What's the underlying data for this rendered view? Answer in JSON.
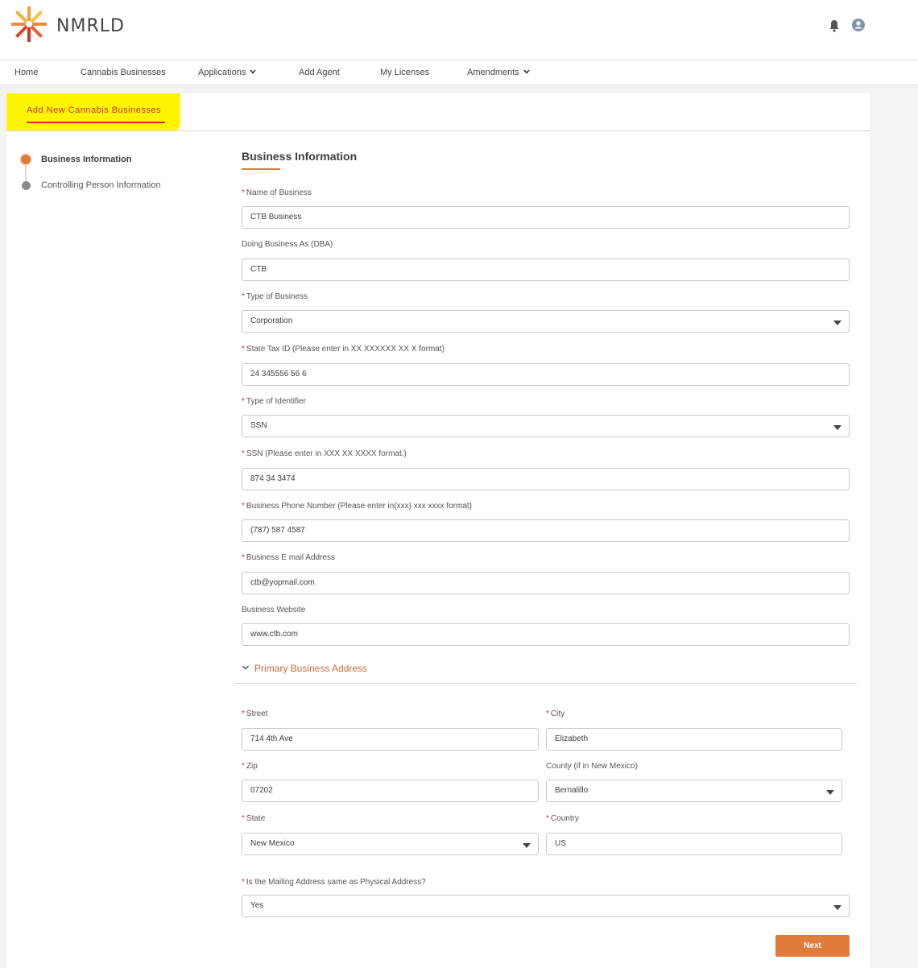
{
  "brand": {
    "name": "NMRLD"
  },
  "icons": {
    "logo": "starburst-logo-icon",
    "bell": "bell-icon",
    "avatar": "user-avatar-icon",
    "chevron": "chevron-down-icon"
  },
  "colors": {
    "accent": "#e07b3c",
    "tab_text": "#c9302c",
    "required": "#c23934",
    "highlight": "#fff500",
    "step_active": "#e07b3c",
    "step_inactive": "#8a8a8a"
  },
  "nav": {
    "home": "Home",
    "cannabis_businesses": "Cannabis Businesses",
    "applications": "Applications",
    "add_agent": "Add Agent",
    "my_licenses": "My Licenses",
    "amendments": "Amendments"
  },
  "tab": {
    "label": "Add New Cannabis Businesses"
  },
  "steps": [
    {
      "label": "Business Information",
      "active": true
    },
    {
      "label": "Controlling Person Information",
      "active": false
    }
  ],
  "section": {
    "title": "Business Information"
  },
  "fields": {
    "name": {
      "label": "Name of Business",
      "required": true,
      "value": "CTB Business"
    },
    "dba": {
      "label": "Doing Business As (DBA)",
      "required": false,
      "value": "CTB"
    },
    "type": {
      "label": "Type of Business",
      "required": true,
      "value": "Corporation"
    },
    "tax_id": {
      "label": "State Tax ID (Please enter in XX XXXXXX XX X format)",
      "required": true,
      "value": "24 345556 56 6"
    },
    "id_type": {
      "label": "Type of Identifier",
      "required": true,
      "value": "SSN"
    },
    "ssn": {
      "label": "SSN (Please enter in XXX XX XXXX format.)",
      "required": true,
      "value": "874 34 3474"
    },
    "phone": {
      "label": "Business Phone Number (Please enter in(xxx) xxx xxxx format)",
      "required": true,
      "value": "(787) 587 4587"
    },
    "email": {
      "label": "Business E mail Address",
      "required": true,
      "value": "ctb@yopmail.com"
    },
    "website": {
      "label": "Business Website",
      "required": false,
      "value": "www.ctb.com"
    }
  },
  "address": {
    "heading": "Primary Business Address",
    "street": {
      "label": "Street",
      "value": "714 4th Ave"
    },
    "city": {
      "label": "City",
      "value": "Elizabeth"
    },
    "zip": {
      "label": "Zip",
      "value": "07202"
    },
    "county": {
      "label": "County (if in New Mexico)",
      "value": "Bernalillo"
    },
    "state": {
      "label": "State",
      "value": "New Mexico"
    },
    "country": {
      "label": "Country",
      "value": "US"
    },
    "mailing": {
      "label": "Is the Mailing Address same as Physical Address?",
      "value": "Yes"
    }
  },
  "actions": {
    "next": "Next"
  }
}
